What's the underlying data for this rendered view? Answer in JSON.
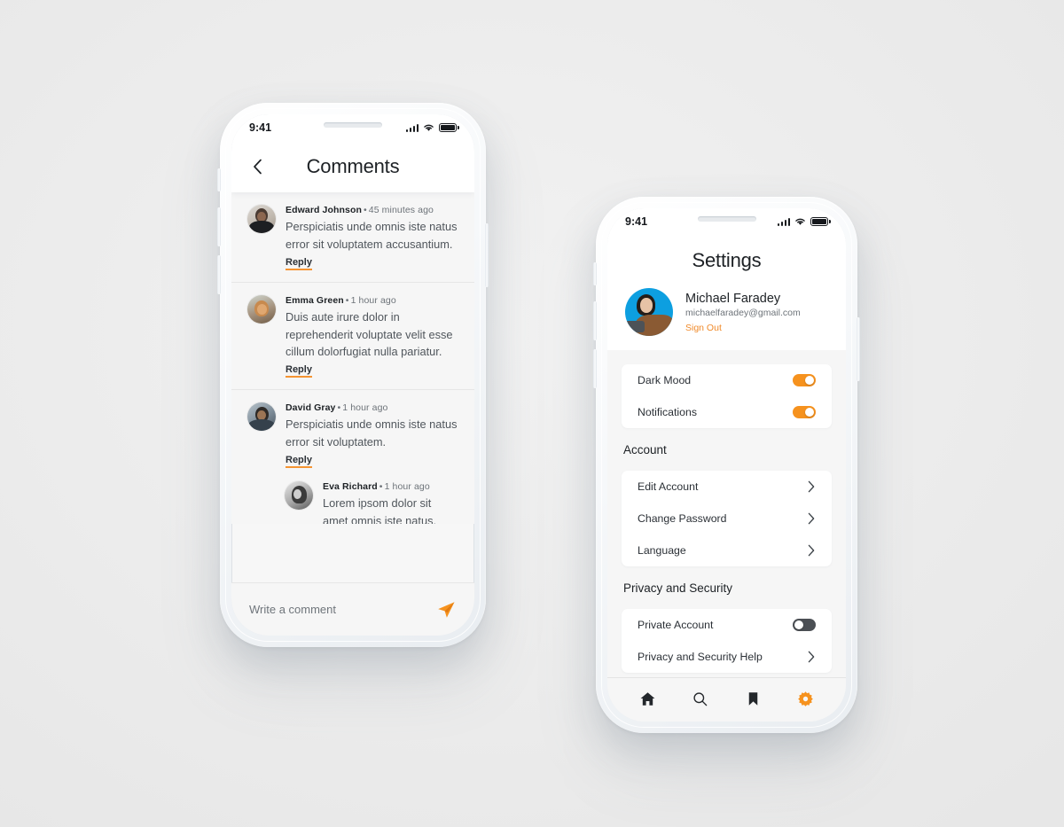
{
  "background_color": "#eceded",
  "accent_color": "#f6921e",
  "phones": {
    "left": {
      "name": "comments-phone",
      "status_bar": {
        "time": "9:41",
        "signal_icon": "signal-bars-icon",
        "wifi_icon": "wifi-icon",
        "battery_icon": "battery-icon"
      },
      "header": {
        "back_icon": "chevron-left-icon",
        "title": "Comments"
      },
      "comments": [
        {
          "author": "Edward Johnson",
          "separator": "•",
          "time": "45 minutes ago",
          "text": "Perspiciatis unde omnis iste natus error sit voluptatem accusantium.",
          "reply_label": "Reply",
          "avatar": "avatar-edward-johnson"
        },
        {
          "author": "Emma Green",
          "separator": "•",
          "time": "1 hour ago",
          "text": "Duis aute irure dolor in reprehenderit voluptate velit esse cillum dolorfugiat nulla pariatur.",
          "reply_label": "Reply",
          "avatar": "avatar-emma-green"
        },
        {
          "author": "David Gray",
          "separator": "•",
          "time": "1 hour ago",
          "text": "Perspiciatis unde omnis iste natus error sit voluptatem.",
          "reply_label": "Reply",
          "avatar": "avatar-david-gray"
        }
      ],
      "nested_reply": {
        "author": "Eva Richard",
        "separator": "•",
        "time": "1 hour ago",
        "text": "Lorem ipsom dolor sit amet omnis iste natus.",
        "avatar": "avatar-eva-richard"
      },
      "compose": {
        "placeholder": "Write a comment",
        "send_icon": "send-paper-plane-icon"
      }
    },
    "right": {
      "name": "settings-phone",
      "status_bar": {
        "time": "9:41",
        "signal_icon": "signal-bars-icon",
        "wifi_icon": "wifi-icon",
        "battery_icon": "battery-icon"
      },
      "title": "Settings",
      "profile": {
        "name": "Michael Faradey",
        "email": "michaelfaradey@gmail.com",
        "sign_out_label": "Sign Out",
        "avatar": "avatar-michael-faradey",
        "avatar_bg_color": "#0d9fe0"
      },
      "preferences": [
        {
          "label": "Dark Mood",
          "control": "toggle",
          "state": "on"
        },
        {
          "label": "Notifications",
          "control": "toggle",
          "state": "on"
        }
      ],
      "account_section": {
        "title": "Account",
        "items": [
          {
            "label": "Edit Account",
            "control": "chevron"
          },
          {
            "label": "Change Password",
            "control": "chevron"
          },
          {
            "label": "Language",
            "control": "chevron"
          }
        ]
      },
      "privacy_section": {
        "title": "Privacy and Security",
        "items": [
          {
            "label": "Private Account",
            "control": "toggle",
            "state": "off"
          },
          {
            "label": "Privacy and Security Help",
            "control": "chevron"
          }
        ]
      },
      "tabbar": [
        {
          "icon": "home-icon",
          "active": false
        },
        {
          "icon": "search-icon",
          "active": false
        },
        {
          "icon": "bookmark-icon",
          "active": false
        },
        {
          "icon": "gear-icon",
          "active": true
        }
      ]
    }
  }
}
